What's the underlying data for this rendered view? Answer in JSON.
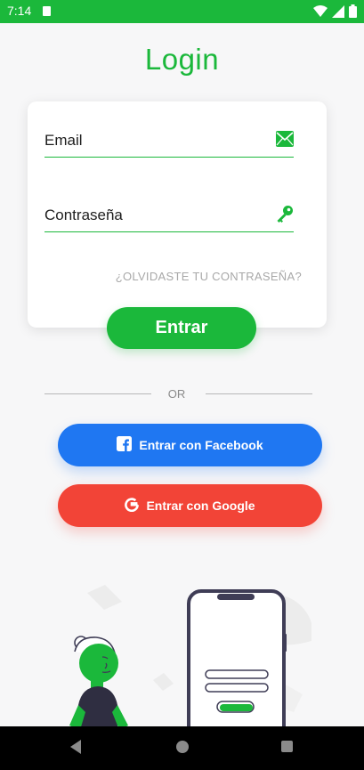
{
  "status_bar": {
    "time": "7:14"
  },
  "login": {
    "title": "Login",
    "email_label": "Email",
    "password_label": "Contraseña",
    "forgot_password": "¿OLVIDASTE TU CONTRASEÑA?",
    "submit_label": "Entrar"
  },
  "divider": {
    "text": "OR"
  },
  "social": {
    "facebook_label": "Entrar con Facebook",
    "google_label": "Entrar con Google"
  },
  "icons": {
    "email": "mail-icon",
    "password": "key-icon",
    "facebook": "facebook-icon",
    "google": "google-icon"
  },
  "colors": {
    "primary": "#1bb83b",
    "facebook": "#1f77f2",
    "google": "#f24437",
    "status_bar": "#1bb83b"
  }
}
